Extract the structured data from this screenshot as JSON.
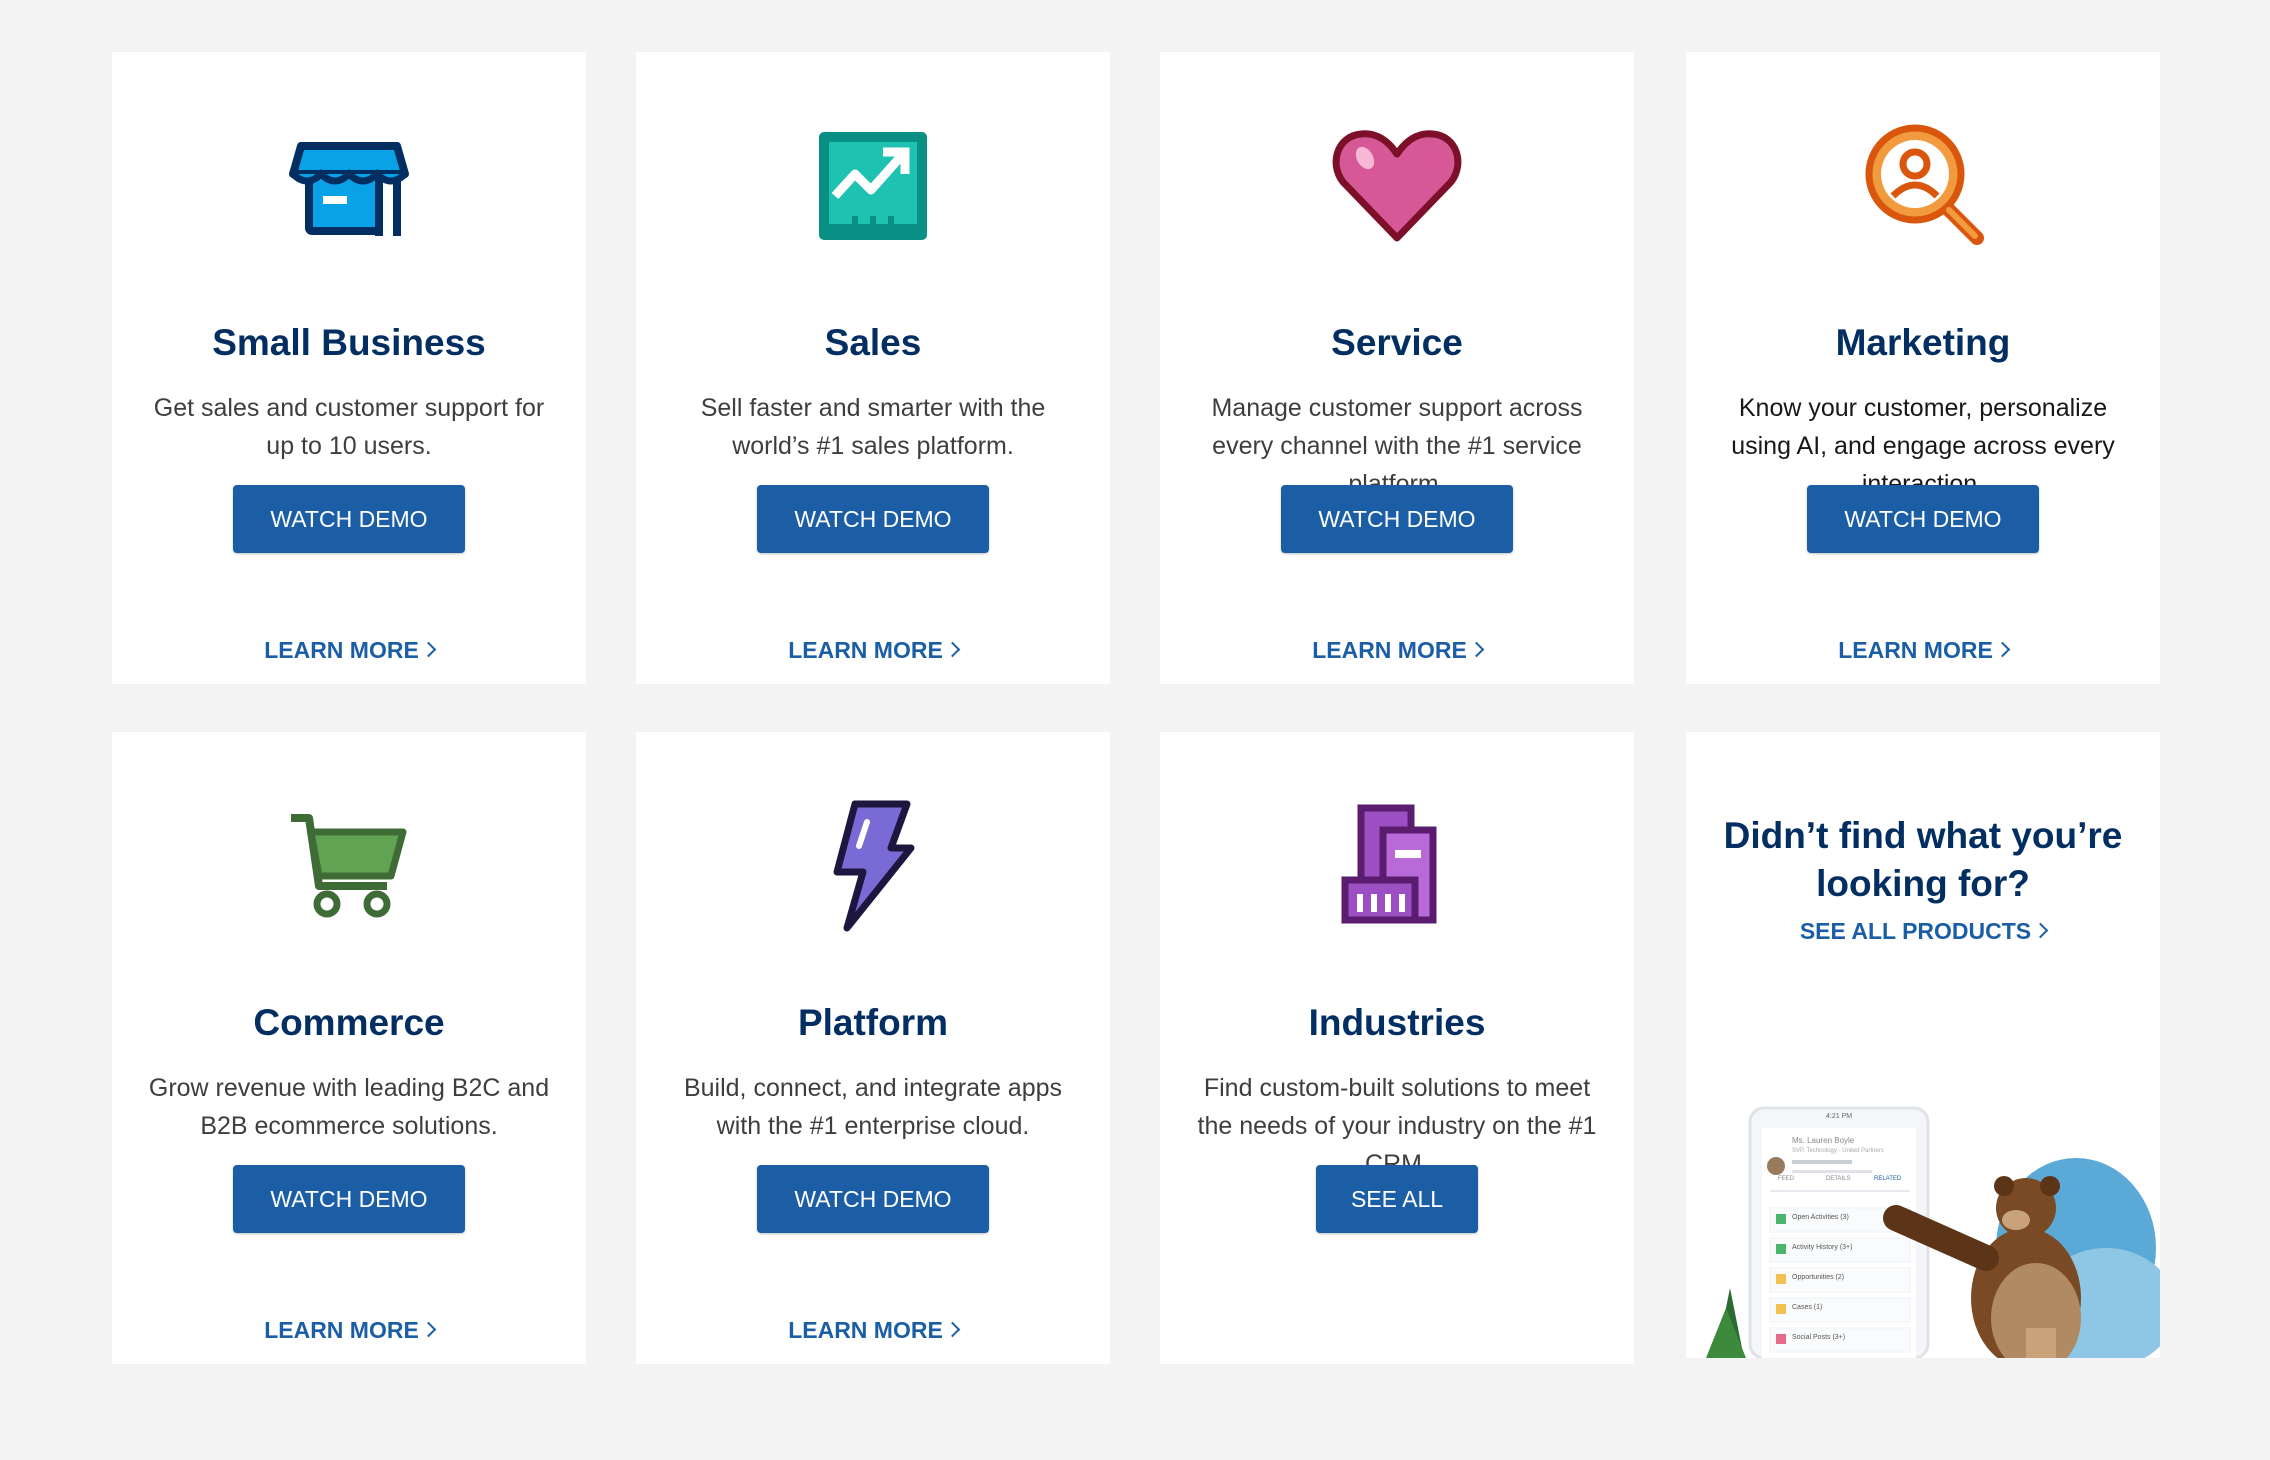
{
  "cards": [
    {
      "title": "Small Business",
      "desc": "Get sales and customer support for up to 10 users.",
      "button": "WATCH DEMO",
      "link": "LEARN MORE"
    },
    {
      "title": "Sales",
      "desc": "Sell faster and smarter with the world’s #1 sales platform.",
      "button": "WATCH DEMO",
      "link": "LEARN MORE"
    },
    {
      "title": "Service",
      "desc": "Manage customer support across every channel with the #1 service platform.",
      "button": "WATCH DEMO",
      "link": "LEARN MORE"
    },
    {
      "title": "Marketing",
      "desc": "Know your customer, personalize using AI, and engage across every interaction.",
      "button": "WATCH DEMO",
      "link": "LEARN MORE"
    },
    {
      "title": "Commerce",
      "desc": "Grow revenue with leading B2C and B2B ecommerce solutions.",
      "button": "WATCH DEMO",
      "link": "LEARN MORE"
    },
    {
      "title": "Platform",
      "desc": "Build, connect, and integrate apps with the #1 enterprise cloud.",
      "button": "WATCH DEMO",
      "link": "LEARN MORE"
    },
    {
      "title": "Industries",
      "desc": "Find custom-built solutions to meet the needs of your industry on the #1 CRM.",
      "button": "SEE ALL"
    }
  ],
  "find": {
    "title": "Didn’t find what you’re looking for?",
    "link": "SEE ALL PRODUCTS"
  },
  "phone": {
    "time": "4:21 PM",
    "contact_name": "Ms. Lauren Boyle",
    "contact_sub": "SVP, Technology · United Partners",
    "tabs": [
      "FEED",
      "DETAILS",
      "RELATED"
    ],
    "rows": [
      "Open Activities (3)",
      "Activity History (3+)",
      "Opportunities (2)",
      "Cases (1)",
      "Social Posts (3+)"
    ]
  },
  "colors": {
    "accent": "#1b5ea6",
    "heading": "#032e61",
    "card_bg": "#ffffff",
    "page_bg": "#f3f3f3"
  }
}
